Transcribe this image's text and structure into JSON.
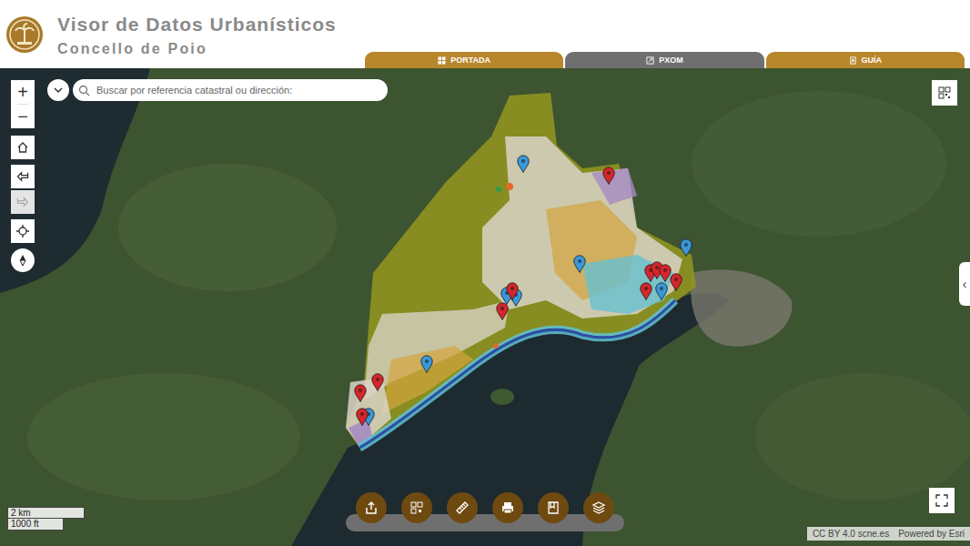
{
  "header": {
    "title": "Visor de Datos Urbanísticos",
    "subtitle": "Concello de Poio"
  },
  "tabs": [
    {
      "label": "PORTADA",
      "selected": false
    },
    {
      "label": "PXOM",
      "selected": true
    },
    {
      "label": "GUÍA",
      "selected": false
    }
  ],
  "search": {
    "placeholder": "Buscar por referencia catastral ou dirección:"
  },
  "zoom": {
    "in": "+",
    "out": "−"
  },
  "history": [
    {
      "kind": "back",
      "disabled": false
    },
    {
      "kind": "forward",
      "disabled": true
    }
  ],
  "markers": [
    {
      "color": "#3a97d8"
    },
    {
      "color": "#3a97d8"
    },
    {
      "color": "#3a97d8"
    },
    {
      "color": "#3a97d8"
    },
    {
      "color": "#3a97d8"
    },
    {
      "color": "#3a97d8"
    },
    {
      "color": "#3a97d8"
    },
    {
      "color": "#3a97d8"
    },
    {
      "color": "#d4262b"
    },
    {
      "color": "#d4262b"
    },
    {
      "color": "#d4262b"
    },
    {
      "color": "#d4262b"
    },
    {
      "color": "#d4262b"
    },
    {
      "color": "#d4262b"
    },
    {
      "color": "#d4262b"
    },
    {
      "color": "#d4262b"
    },
    {
      "color": "#d4262b"
    },
    {
      "color": "#d4262b"
    },
    {
      "color": "#d4262b"
    }
  ],
  "scale": {
    "metric": "2 km",
    "imperial": "1000 ft"
  },
  "attribution": [
    "CC BY 4.0 scne.es",
    "Powered by Esri"
  ],
  "side_panel": {
    "toggle": "‹",
    "expanded": false
  }
}
